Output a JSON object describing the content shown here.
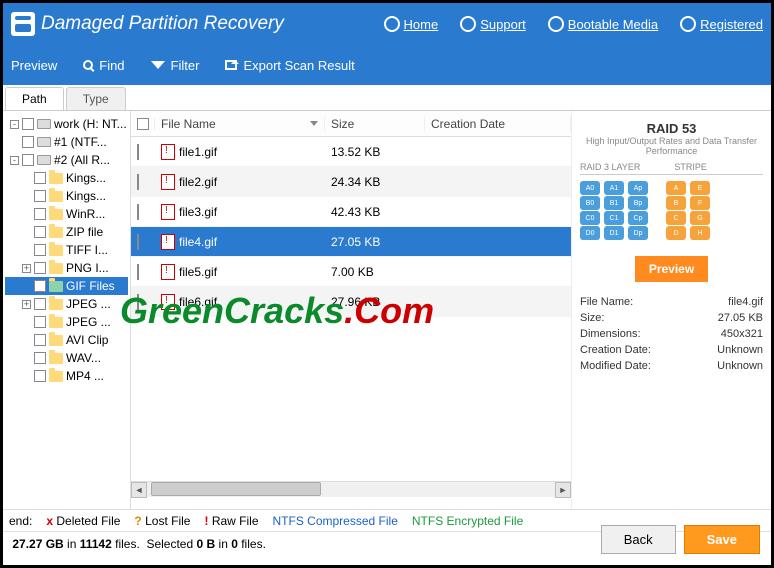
{
  "header": {
    "title": "Damaged Partition Recovery",
    "links": [
      "Home",
      "Support",
      "Bootable Media",
      "Registered"
    ]
  },
  "toolbar": {
    "preview": "Preview",
    "find": "Find",
    "filter": "Filter",
    "export": "Export Scan Result"
  },
  "tabs": {
    "path": "Path",
    "type": "Type"
  },
  "tree": [
    {
      "indent": 0,
      "exp": "-",
      "icon": "drive",
      "label": "work (H: NT..."
    },
    {
      "indent": 0,
      "exp": "",
      "icon": "drive",
      "label": "#1 (NTF..."
    },
    {
      "indent": 0,
      "exp": "-",
      "icon": "drive",
      "label": "#2 (All R..."
    },
    {
      "indent": 1,
      "exp": "",
      "icon": "folder",
      "label": "Kings..."
    },
    {
      "indent": 1,
      "exp": "",
      "icon": "folder",
      "label": "Kings..."
    },
    {
      "indent": 1,
      "exp": "",
      "icon": "folder",
      "label": "WinR..."
    },
    {
      "indent": 1,
      "exp": "",
      "icon": "folder",
      "label": "ZIP file"
    },
    {
      "indent": 1,
      "exp": "",
      "icon": "folder",
      "label": "TIFF I..."
    },
    {
      "indent": 1,
      "exp": "+",
      "icon": "folder",
      "label": "PNG I..."
    },
    {
      "indent": 1,
      "exp": "",
      "icon": "folder-sel",
      "label": "GIF Files",
      "sel": true
    },
    {
      "indent": 1,
      "exp": "+",
      "icon": "folder",
      "label": "JPEG ..."
    },
    {
      "indent": 1,
      "exp": "",
      "icon": "folder",
      "label": "JPEG ..."
    },
    {
      "indent": 1,
      "exp": "",
      "icon": "folder",
      "label": "AVI Clip"
    },
    {
      "indent": 1,
      "exp": "",
      "icon": "folder",
      "label": "WAV..."
    },
    {
      "indent": 1,
      "exp": "",
      "icon": "folder",
      "label": "MP4 ..."
    }
  ],
  "filelist": {
    "headers": {
      "name": "File Name",
      "size": "Size",
      "date": "Creation Date"
    },
    "rows": [
      {
        "name": "file1.gif",
        "size": "13.52 KB"
      },
      {
        "name": "file2.gif",
        "size": "24.34 KB"
      },
      {
        "name": "file3.gif",
        "size": "42.43 KB"
      },
      {
        "name": "file4.gif",
        "size": "27.05 KB",
        "sel": true
      },
      {
        "name": "file5.gif",
        "size": "7.00 KB"
      },
      {
        "name": "file6.gif",
        "size": "27.96 KB"
      }
    ]
  },
  "sidepanel": {
    "raid_title": "RAID 53",
    "raid_sub": "High Input/Output Rates and Data Transfer Performance",
    "raid_l": "RAID 3 LAYER",
    "raid_r": "STRIPE",
    "preview_btn": "Preview",
    "meta": [
      {
        "k": "File Name:",
        "v": "file4.gif"
      },
      {
        "k": "Size:",
        "v": "27.05 KB"
      },
      {
        "k": "Dimensions:",
        "v": "450x321"
      },
      {
        "k": "Creation Date:",
        "v": "Unknown"
      },
      {
        "k": "Modified Date:",
        "v": "Unknown"
      }
    ]
  },
  "legend": {
    "label": "end:",
    "deleted": "Deleted File",
    "lost": "Lost File",
    "raw": "Raw File",
    "ntfs": "NTFS Compressed File",
    "enc": "NTFS Encrypted File"
  },
  "status": {
    "total_gb": "27.27 GB",
    "total_files": "11142",
    "sel_b": "0 B",
    "sel_files": "0",
    "template": " in  files.  Selected  in  files."
  },
  "buttons": {
    "back": "Back",
    "save": "Save"
  },
  "watermark": {
    "a": "GreenCracks",
    "b": ".",
    "c": "Com"
  }
}
